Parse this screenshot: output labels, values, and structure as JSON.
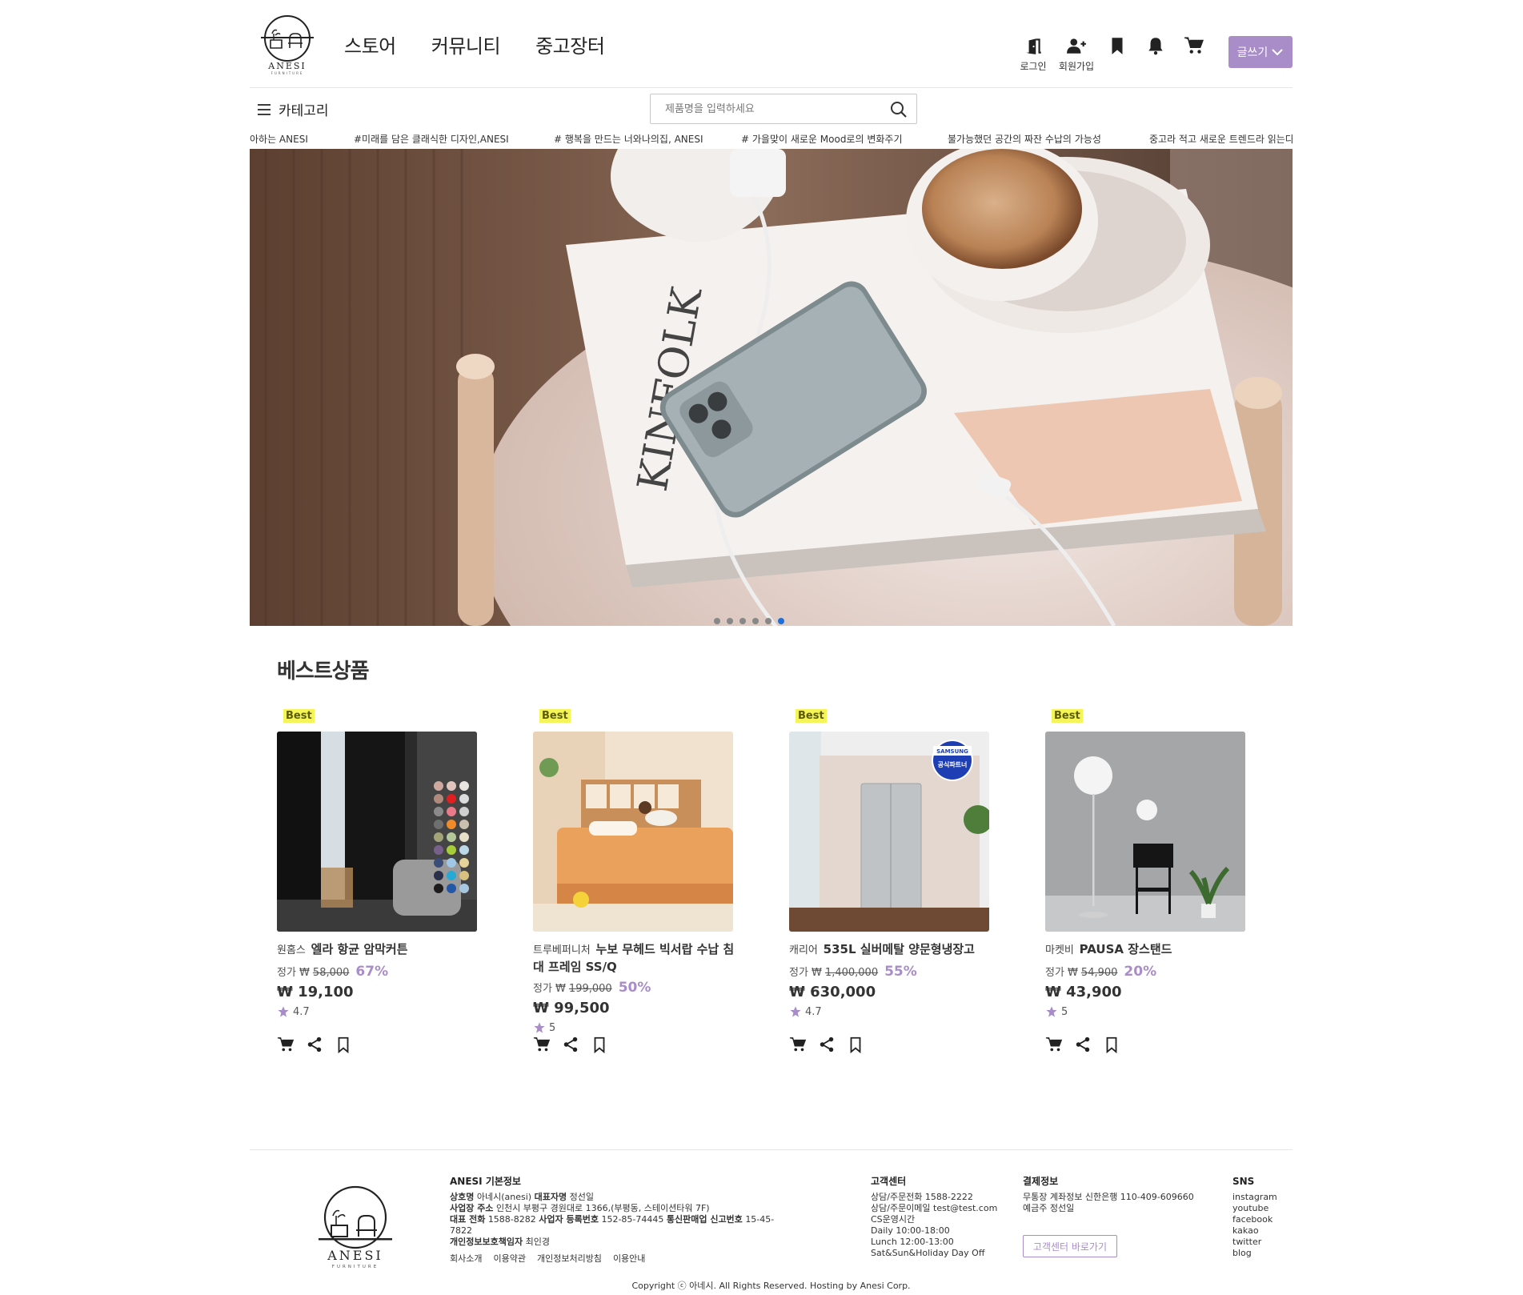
{
  "brand": {
    "logo_text": "ANESI",
    "logo_sub": "FURNITURE"
  },
  "nav": {
    "items": [
      "스토어",
      "커뮤니티",
      "중고장터"
    ]
  },
  "user_menu": {
    "login_label": "로그인",
    "signup_label": "회원가입",
    "write_label": "글쓰기",
    "icons": [
      "login-door-icon",
      "add-user-icon",
      "bookmark-icon",
      "bell-icon",
      "cart-icon",
      "chevron-down-icon"
    ]
  },
  "category": {
    "label": "카테고리"
  },
  "search": {
    "placeholder": "제품명을 입력하세요"
  },
  "ticker": {
    "items": [
      "아하는 ANESI",
      "#미래를 담은 클래식한 디자인,ANESI",
      "# 행복을 만드는 너와나의집, ANESI",
      "# 가을맞이 새로운 Mood로의 변화주기",
      "불가능했던 공간의 짜잔 수납의 가능성",
      "중고라 적고 새로운 트렌드라 읽는다"
    ]
  },
  "hero": {
    "slides": 6,
    "active_index": 5
  },
  "best": {
    "title": "베스트상품",
    "products": [
      {
        "badge": "Best",
        "brand": "원홈스",
        "name": "엘라 항균 암막커튼",
        "price_label": "정가 ₩",
        "original": "58,000",
        "discount": "67%",
        "sale": "₩ 19,100",
        "rating": "4.7"
      },
      {
        "badge": "Best",
        "brand": "트루베퍼니처",
        "name": "누보 무헤드 빅서랍 수납 침대 프레임 SS/Q",
        "price_label": "정가 ₩",
        "original": "199,000",
        "discount": "50%",
        "sale": "₩ 99,500",
        "rating": "5"
      },
      {
        "badge": "Best",
        "brand": "캐리어",
        "name": "535L 실버메탈 양문형냉장고",
        "price_label": "정가 ₩",
        "original": "1,400,000",
        "discount": "55%",
        "sale": "₩ 630,000",
        "rating": "4.7"
      },
      {
        "badge": "Best",
        "brand": "마켓비",
        "name": "PAUSA 장스탠드",
        "price_label": "정가 ₩",
        "original": "54,900",
        "discount": "20%",
        "sale": "₩ 43,900",
        "rating": "5"
      }
    ],
    "samsung_badge": {
      "top": "SAMSUNG",
      "bottom": "공식파트너"
    }
  },
  "footer": {
    "info_title": "ANESI 기본정보",
    "info_lines": [
      {
        "k1": "상호명",
        "v1": "아네시(anesi)",
        "k2": "대표자명",
        "v2": "정선일"
      },
      {
        "k1": "사업장 주소",
        "v1": "인천시 부평구 경원대로 1366,(부평동, 스테이션타워 7F)",
        "k2": "",
        "v2": ""
      },
      {
        "k1": "대표 전화",
        "v1": "1588-8282",
        "k2": "사업자 등록번호",
        "v2": "152-85-74445",
        "k3": "통신판매업 신고번호",
        "v3": "15-45-7822"
      },
      {
        "k1": "개인정보보호책임자",
        "v1": "최인경",
        "k2": "",
        "v2": ""
      }
    ],
    "links": [
      "회사소개",
      "이용약관",
      "개인정보처리방침",
      "이용안내"
    ],
    "cs_title": "고객센터",
    "cs_lines": [
      "상담/주문전화 1588-2222",
      "상담/주문이메일 test@test.com",
      "CS운영시간",
      "Daily 10:00-18:00",
      "Lunch 12:00-13:00",
      "Sat&Sun&Holiday Day Off"
    ],
    "pay_title": "결제정보",
    "pay_lines": [
      "무통장 계좌정보 신한은행 110-409-609660",
      "예금주 정선일"
    ],
    "cs_button": "고객센터 바로가기",
    "sns_title": "SNS",
    "sns": [
      "instagram",
      "youtube",
      "facebook",
      "kakao",
      "twitter",
      "blog"
    ],
    "copyright": "Copyright ⓒ 아네시. All Rights Reserved. Hosting by Anesi Corp."
  },
  "colors": {
    "accent": "#a98dc9",
    "badge_bg": "#f5f55a",
    "dot_active": "#1e6fd9"
  }
}
